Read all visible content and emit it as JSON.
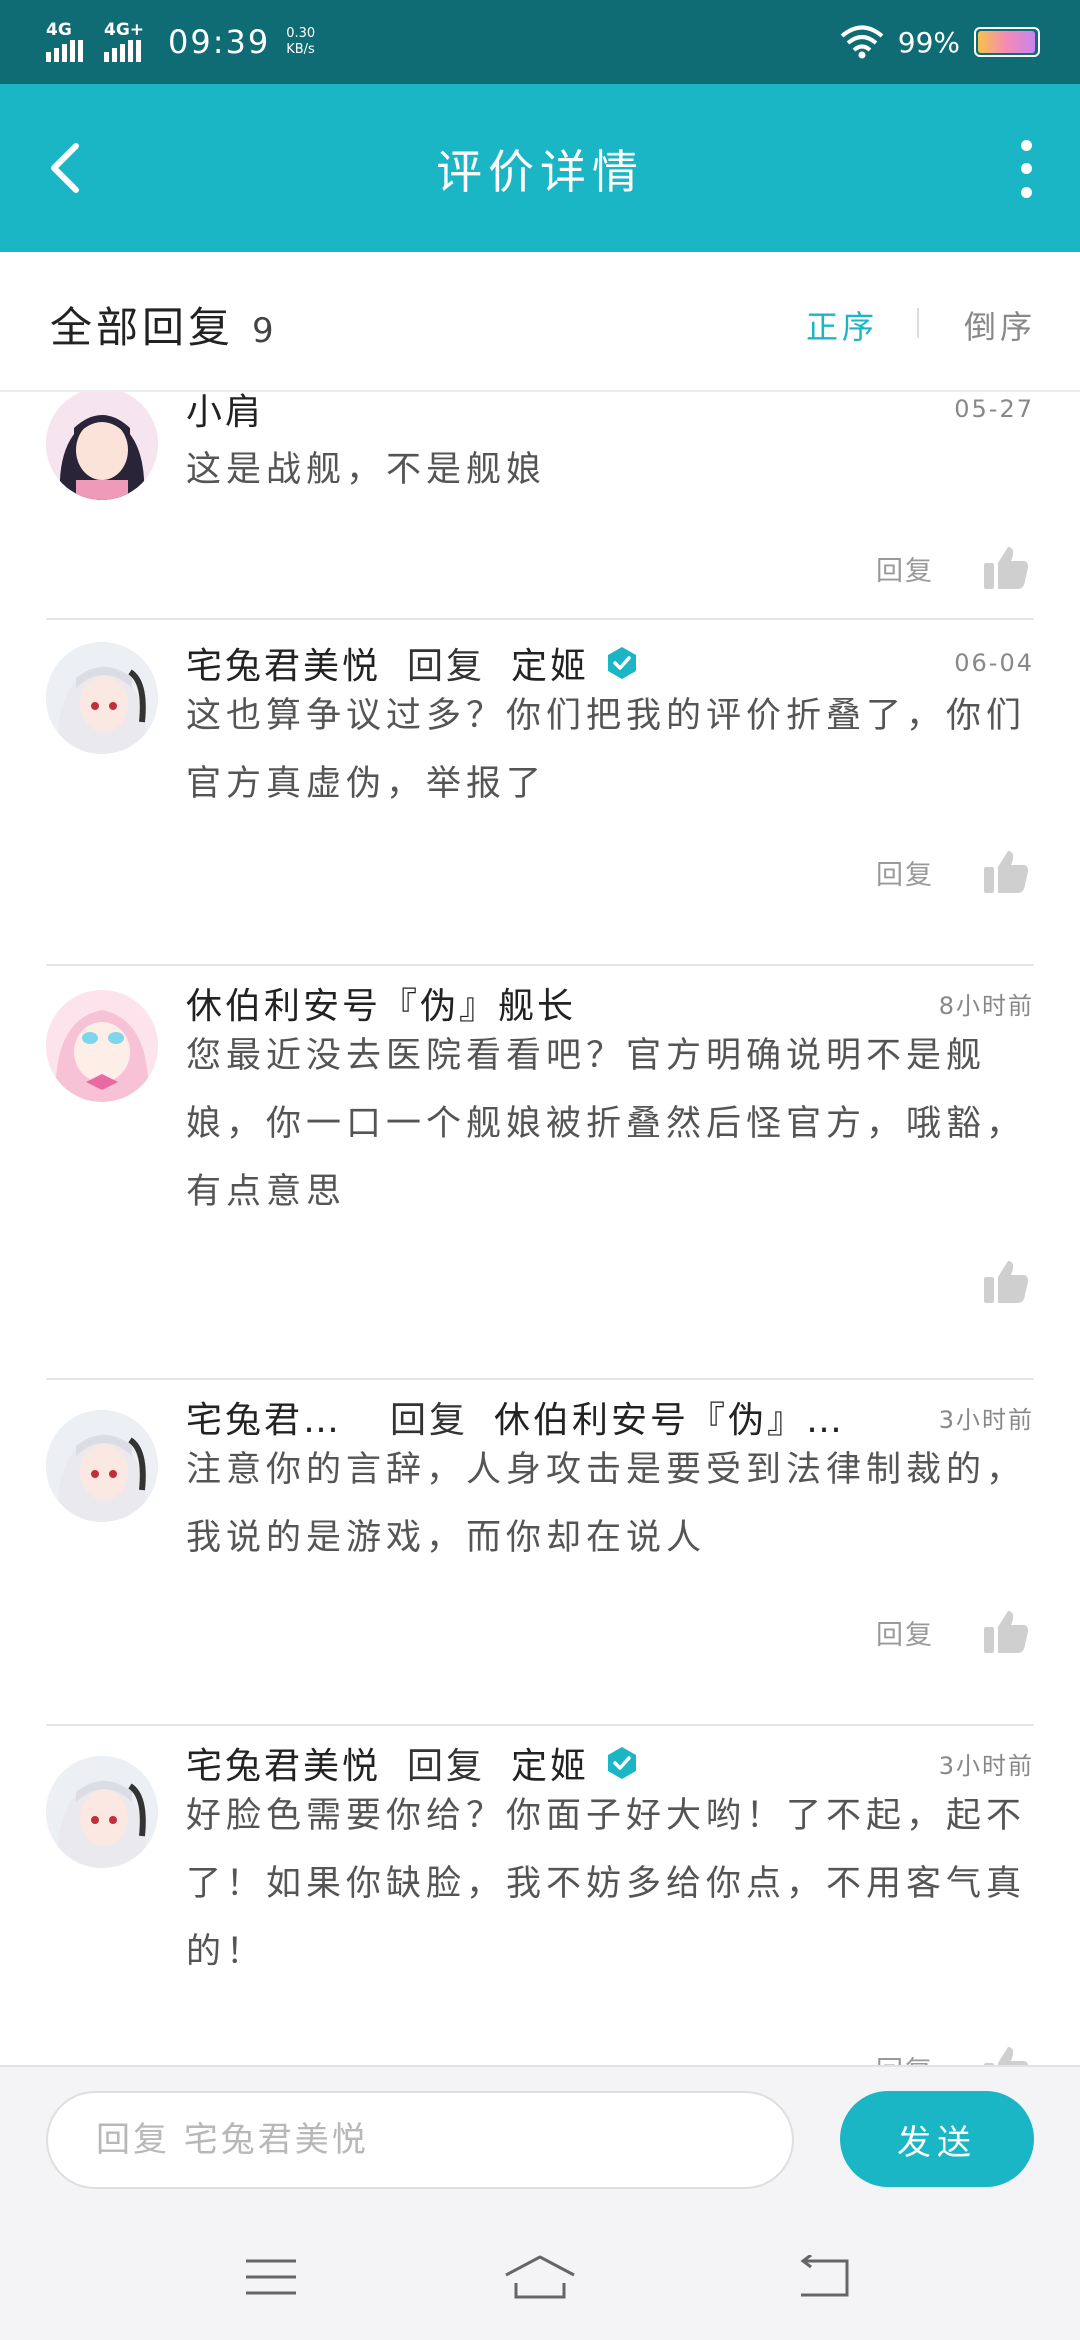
{
  "status_bar": {
    "network1": "4G",
    "network2": "4G+",
    "time": "09:39",
    "speed_value": "0.30",
    "speed_unit": "KB/s",
    "battery": "99%",
    "battery_level": 0.99
  },
  "header": {
    "title": "评价详情",
    "back_icon": "chevron-left-icon",
    "more_icon": "more-vertical-icon"
  },
  "sort_bar": {
    "label": "全部回复",
    "count": "9",
    "asc_label": "正序",
    "desc_label": "倒序",
    "active_color": "#1bb6c6"
  },
  "comments": [
    {
      "user": "小肩",
      "time": "05-27",
      "text": "这是战舰，不是舰娘",
      "reply_label": "回复",
      "avatar": "girl-dark-hair"
    },
    {
      "user": "宅兔君美悦",
      "reply_word": "回复",
      "target": "定姬",
      "verified": true,
      "time": "06-04",
      "text": "这也算争议过多？你们把我的评价折叠了，你们官方真虚伪，举报了",
      "reply_label": "回复",
      "avatar": "girl-white-hair"
    },
    {
      "user": "休伯利安号『伪』舰长",
      "time": "8小时前",
      "text": "您最近没去医院看看吧？官方明确说明不是舰娘，你一口一个舰娘被折叠然后怪官方，哦豁，有点意思",
      "avatar": "girl-pink-hair"
    },
    {
      "user": "宅兔君…",
      "reply_word": "回复",
      "target": "休伯利安号『伪』…",
      "time": "3小时前",
      "text": "注意你的言辞，人身攻击是要受到法律制裁的，我说的是游戏，而你却在说人",
      "reply_label": "回复",
      "avatar": "girl-white-hair"
    },
    {
      "user": "宅兔君美悦",
      "reply_word": "回复",
      "target": "定姬",
      "verified": true,
      "time": "3小时前",
      "text": "好脸色需要你给？你面子好大哟！了不起，起不了！如果你缺脸，我不妨多给你点，不用客气真的！",
      "reply_label": "回复",
      "avatar": "girl-white-hair"
    }
  ],
  "input_bar": {
    "placeholder": "回复 宅兔君美悦",
    "send_label": "发送"
  },
  "nav_bar": {
    "menu_icon": "menu-icon",
    "home_icon": "home-icon",
    "back_icon": "back-icon"
  }
}
